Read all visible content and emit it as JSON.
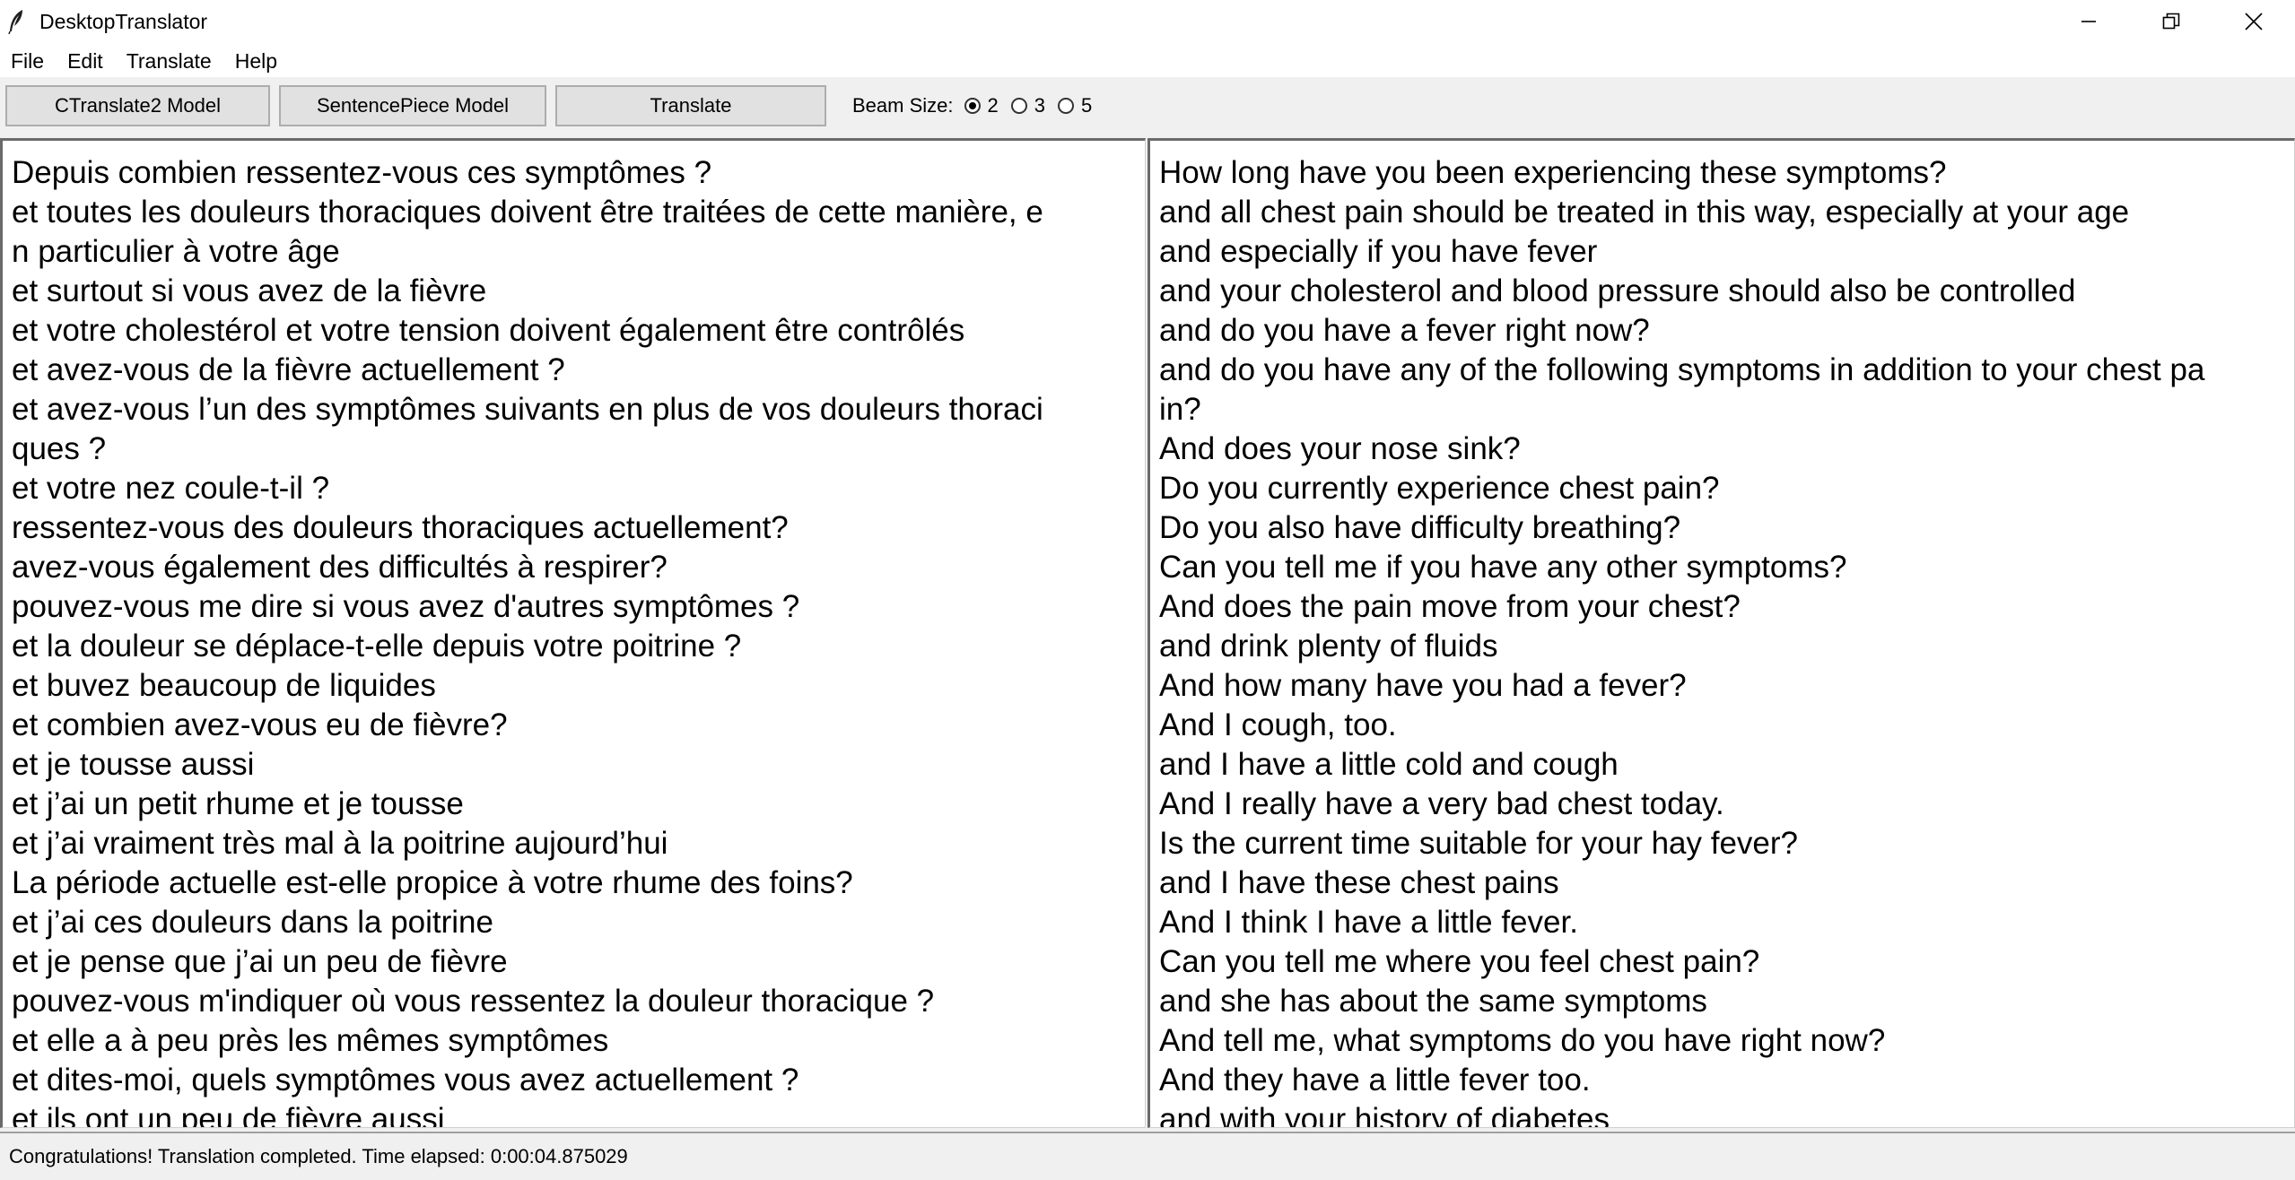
{
  "window": {
    "title": "DesktopTranslator"
  },
  "menu": [
    "File",
    "Edit",
    "Translate",
    "Help"
  ],
  "toolbar": {
    "ctranslate_label": "CTranslate2 Model",
    "sentencepiece_label": "SentencePiece Model",
    "translate_label": "Translate",
    "beam_label": "Beam Size:",
    "beam_options": [
      "2",
      "3",
      "5"
    ],
    "beam_selected": "2"
  },
  "source_lines": [
    "Depuis combien ressentez-vous ces symptômes ?",
    "et toutes les douleurs thoraciques doivent être traitées de cette manière, e",
    "n particulier à votre âge",
    "et surtout si vous avez de la fièvre",
    "et votre cholestérol et votre tension doivent également être contrôlés",
    "et avez-vous de la fièvre actuellement ?",
    "et avez-vous l’un des symptômes suivants en plus de vos douleurs thoraci",
    "ques ?",
    "et votre nez coule-t-il ?",
    "ressentez-vous des douleurs thoraciques actuellement?",
    "avez-vous également des difficultés à respirer?",
    "pouvez-vous me dire si vous avez d'autres symptômes ?",
    "et la douleur se déplace-t-elle depuis votre poitrine ?",
    "et buvez beaucoup de liquides",
    "et combien avez-vous eu de fièvre?",
    "et je tousse aussi",
    "et j’ai un petit rhume et je tousse",
    "et j’ai vraiment très mal à la poitrine aujourd’hui",
    "La période actuelle est-elle propice à votre rhume des foins?",
    "et j’ai ces douleurs dans la poitrine",
    "et je pense que j’ai un peu de fièvre",
    "pouvez-vous m'indiquer où vous ressentez la douleur thoracique ?",
    "et elle a à peu près les mêmes symptômes",
    "et dites-moi, quels symptômes vous avez actuellement ?",
    "et ils ont un peu de fièvre aussi"
  ],
  "target_lines": [
    "How long have you been experiencing these symptoms?",
    "and all chest pain should be treated in this way, especially at your age",
    "and especially if you have fever",
    "and your cholesterol and blood pressure should also be controlled",
    "and do you have a fever right now?",
    "and do you have any of the following symptoms in addition to your chest pa",
    "in?",
    "And does your nose sink?",
    "Do you currently experience chest pain?",
    "Do you also have difficulty breathing?",
    "Can you tell me if you have any other symptoms?",
    "And does the pain move from your chest?",
    "and drink plenty of fluids",
    "And how many have you had a fever?",
    "And I cough, too.",
    "and I have a little cold and cough",
    "And I really have a very bad chest today.",
    "Is the current time suitable for your hay fever?",
    "and I have these chest pains",
    "And I think I have a little fever.",
    "Can you tell me where you feel chest pain?",
    "and she has about the same symptoms",
    "And tell me, what symptoms do you have right now?",
    "And they have a little fever too.",
    "and with your history of diabetes"
  ],
  "status": {
    "message": "Congratulations! Translation completed. Time elapsed: 0:00:04.875029"
  }
}
